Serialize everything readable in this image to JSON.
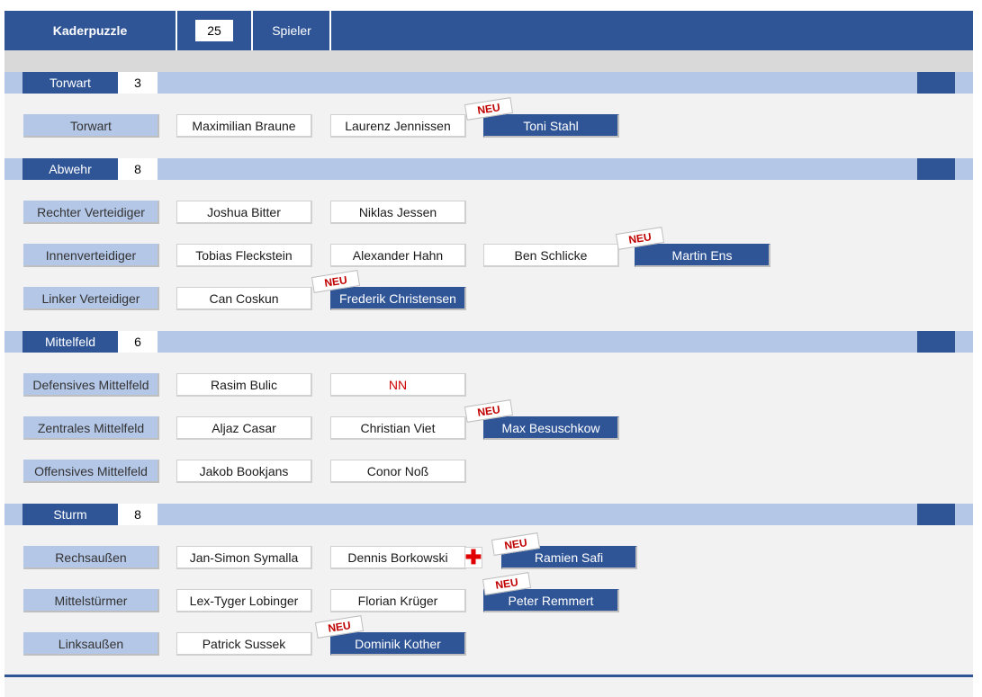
{
  "header": {
    "title": "Kaderpuzzle",
    "count": "25",
    "unit": "Spieler"
  },
  "sections": {
    "torwart": {
      "label": "Torwart",
      "count": "3"
    },
    "abwehr": {
      "label": "Abwehr",
      "count": "8"
    },
    "mittelfeld": {
      "label": "Mittelfeld",
      "count": "6"
    },
    "sturm": {
      "label": "Sturm",
      "count": "8"
    }
  },
  "rows": {
    "torwart": {
      "position": "Torwart",
      "players": [
        "Maximilian Braune",
        "Laurenz Jennissen",
        "Toni Stahl"
      ]
    },
    "rechter_verteidiger": {
      "position": "Rechter Verteidiger",
      "players": [
        "Joshua Bitter",
        "Niklas Jessen"
      ]
    },
    "innenverteidiger": {
      "position": "Innenverteidiger",
      "players": [
        "Tobias Fleckstein",
        "Alexander Hahn",
        "Ben Schlicke",
        "Martin Ens"
      ]
    },
    "linker_verteidiger": {
      "position": "Linker Verteidiger",
      "players": [
        "Can Coskun",
        "Frederik Christensen"
      ]
    },
    "defensives_mittelfeld": {
      "position": "Defensives Mittelfeld",
      "players": [
        "Rasim Bulic",
        "NN"
      ]
    },
    "zentrales_mittelfeld": {
      "position": "Zentrales Mittelfeld",
      "players": [
        "Aljaz Casar",
        "Christian Viet",
        "Max Besuschkow"
      ]
    },
    "offensives_mittelfeld": {
      "position": "Offensives Mittelfeld",
      "players": [
        "Jakob Bookjans",
        "Conor Noß"
      ]
    },
    "rechtsaussen": {
      "position": "Rechsaußen",
      "players": [
        "Jan-Simon Symalla",
        "Dennis Borkowski",
        "Ramien Safi"
      ]
    },
    "mittelstuermer": {
      "position": "Mittelstürmer",
      "players": [
        "Lex-Tyger Lobinger",
        "Florian Krüger",
        "Peter Remmert"
      ]
    },
    "linksaussen": {
      "position": "Linksaußen",
      "players": [
        "Patrick Sussek",
        "Dominik Kother"
      ]
    }
  },
  "badge_text": "NEU",
  "injury_symbol": "✚",
  "colors": {
    "primary": "#2f5597",
    "light": "#b4c7e7",
    "background": "#f2f2f2",
    "badge": "#c00000",
    "injury": "#e00000"
  }
}
